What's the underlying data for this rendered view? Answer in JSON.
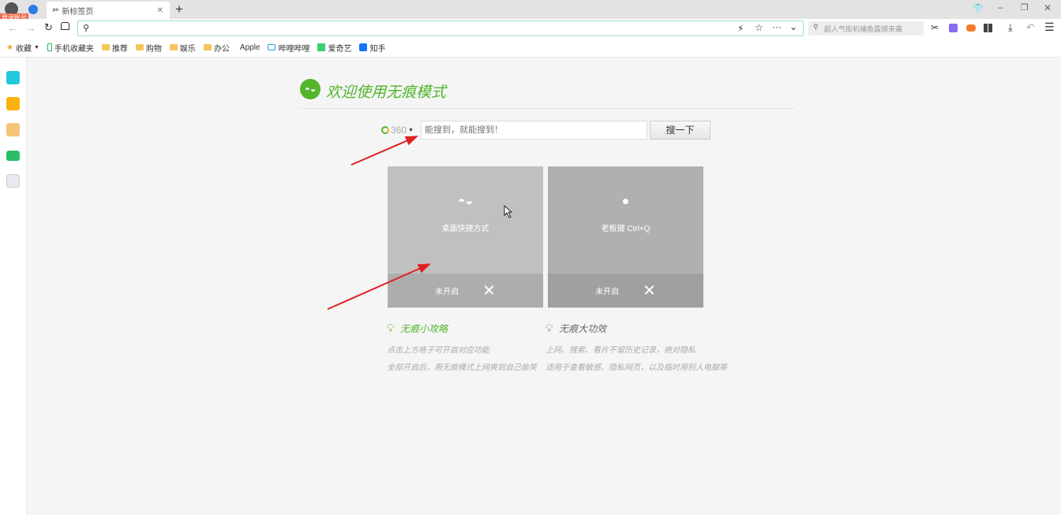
{
  "browser": {
    "login_badge": "登录账号",
    "tab_title": "新标签页",
    "new_tab": "+",
    "address_value": "",
    "search_placeholder": "超人气街机捕鱼震撼来袭",
    "bookmarks": [
      "收藏",
      "手机收藏夹",
      "推荐",
      "购物",
      "娱乐",
      "办公",
      "Apple",
      "哔哩哔哩",
      "爱奇艺",
      "知手"
    ]
  },
  "page": {
    "title": "欢迎使用无痕模式",
    "engine": "360",
    "search_placeholder": "能搜到，就能搜到！",
    "search_button": "搜一下",
    "cards": [
      {
        "label": "桌面快捷方式",
        "status": "未开启"
      },
      {
        "label": "老板键 Ctrl+Q",
        "status": "未开启"
      }
    ],
    "tips": [
      {
        "title": "无痕小攻略",
        "lines": [
          "点击上方格子可开启对应功能",
          "全部开启后，用无痕模式上网爽到自己偷笑"
        ]
      },
      {
        "title": "无痕大功效",
        "lines": [
          "上网、搜索、看片不留历史记录，绝对隐私",
          "适用于查看敏感、隐私网页，以及临时用别人电脑等"
        ]
      }
    ]
  },
  "colors": {
    "accent": "#52b52a",
    "arrow": "#e02020"
  }
}
